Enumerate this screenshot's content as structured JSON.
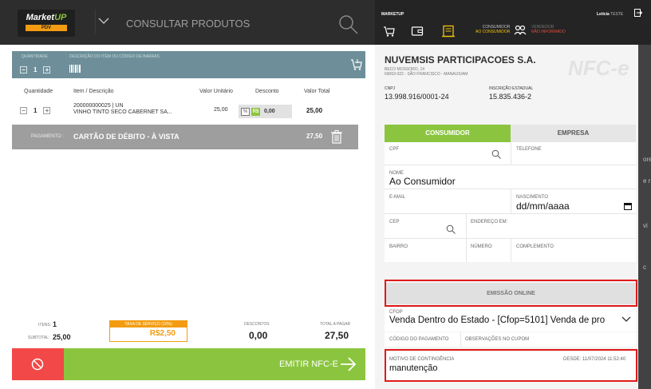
{
  "header": {
    "logo_text": "Market",
    "logo_up": "UP",
    "logo_sub": "PDV",
    "search_placeholder": "CONSULTAR PRODUTOS"
  },
  "input_bar": {
    "qty_label": "QUANTIDADE",
    "desc_label": "DESCRIÇÃO DO ITEM OU CÓDIGO DE BARRAS",
    "qty_value": "1"
  },
  "table": {
    "headers": [
      "Quantidade",
      "Item / Descrição",
      "Valor Unitário",
      "Desconto",
      "Valor Total"
    ],
    "rows": [
      {
        "qty": "1",
        "code": "200000000025 | UN",
        "desc": "VINHO TINTO SECO CABERNET SA...",
        "unit": "25,00",
        "pct": "%",
        "rs": "R$",
        "discount": "0,00",
        "total": "25,00"
      }
    ]
  },
  "payment": {
    "label": "PAGAMENTO :",
    "method": "CARTÃO DE DÉBITO  - À VISTA",
    "total": "27,50"
  },
  "summary": {
    "items_label": "ITENS:",
    "items_value": "1",
    "subtotal_label": "SUBTOTAL:",
    "subtotal_value": "25,00",
    "tax_label": "TAXA DE SERVIÇO (10%)",
    "tax_value": "R$2,50",
    "discounts_label": "DESCONTOS",
    "discounts_value": "0,00",
    "total_label": "TOTAL A PAGAR",
    "total_value": "27,50"
  },
  "actions": {
    "emit_label": "EMITIR NFC-E"
  },
  "right_top": {
    "brand": "MARKETUP",
    "user": "Letícia",
    "user_tag": "TESTE",
    "consumer_l1": "CONSUMIDOR",
    "consumer_l2": "AO CONSUMIDOR",
    "vendor_l1": "VENDEDOR",
    "vendor_l2": "NÃO INFORMADO"
  },
  "company": {
    "name": "NUVEMSIS PARTICIPACOES S.A.",
    "addr1": "BECO MOSSORO, 14",
    "addr2": "69063-022 - SÃO FRANCISCO - MANAUS/AM",
    "cnpj_label": "CNPJ",
    "cnpj": "13.998.916/0001-24",
    "ie_label": "INSCRIÇÃO ESTADUAL",
    "ie": "15.835.436-2",
    "logo_text": "NFC-e"
  },
  "tabs": {
    "consumer": "CONSUMIDOR",
    "company": "EMPRESA"
  },
  "form": {
    "cpf": "CPF",
    "phone": "TELEFONE",
    "name_label": "NOME",
    "name_value": "Ao Consumidor",
    "email": "E-MAIL",
    "birth_label": "NASCIMENTO",
    "birth_value": "dd/mm/aaaa",
    "cep": "CEP",
    "address": "ENDEREÇO EM:",
    "district": "BAIRRO",
    "number": "NÚMERO",
    "complement": "COMPLEMENTO"
  },
  "emission": {
    "label": "EMISSÃO ONLINE"
  },
  "cfop": {
    "label": "CFOP",
    "value": "Venda Dentro do Estado - [Cfop=5101] Venda de pro",
    "payment_code": "CÓDIGO DO PAGAMENTO",
    "notes": "OBSERVAÇÕES NO CUPOM"
  },
  "contingency": {
    "label": "MOTIVO DE CONTINGÊNCIA",
    "since": "DESDE: 11/07/2024 11:52:40",
    "value": "manutenção"
  },
  "edge": [
    "ore",
    "e r",
    "vi",
    "c"
  ]
}
